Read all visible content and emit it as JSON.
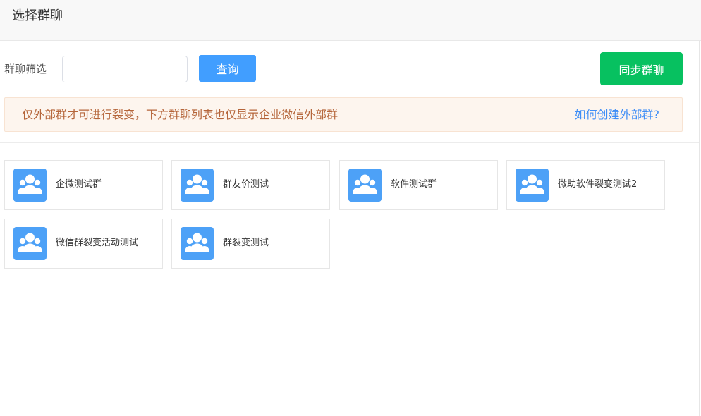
{
  "header": {
    "title": "选择群聊"
  },
  "filter": {
    "label": "群聊筛选",
    "input_value": "",
    "input_placeholder": "",
    "query_label": "查询",
    "sync_label": "同步群聊"
  },
  "notice": {
    "text": "仅外部群才可进行裂变，下方群聊列表也仅显示企业微信外部群",
    "link": "如何创建外部群?"
  },
  "groups": [
    {
      "name": "企微测试群",
      "icon": "group-avatar-icon"
    },
    {
      "name": "群友价测试",
      "icon": "group-avatar-icon"
    },
    {
      "name": "软件测试群",
      "icon": "group-avatar-icon"
    },
    {
      "name": "微助软件裂变测试2",
      "icon": "group-avatar-icon"
    },
    {
      "name": "微信群裂变活动测试",
      "icon": "group-avatar-icon"
    },
    {
      "name": "群裂变测试",
      "icon": "group-avatar-icon"
    }
  ],
  "colors": {
    "query_button": "#419eff",
    "sync_button": "#07c160",
    "notice_bg": "#fdf5ee",
    "notice_text": "#b5653a",
    "notice_link": "#3f8ef6",
    "avatar_bg": "#4da1f7"
  }
}
